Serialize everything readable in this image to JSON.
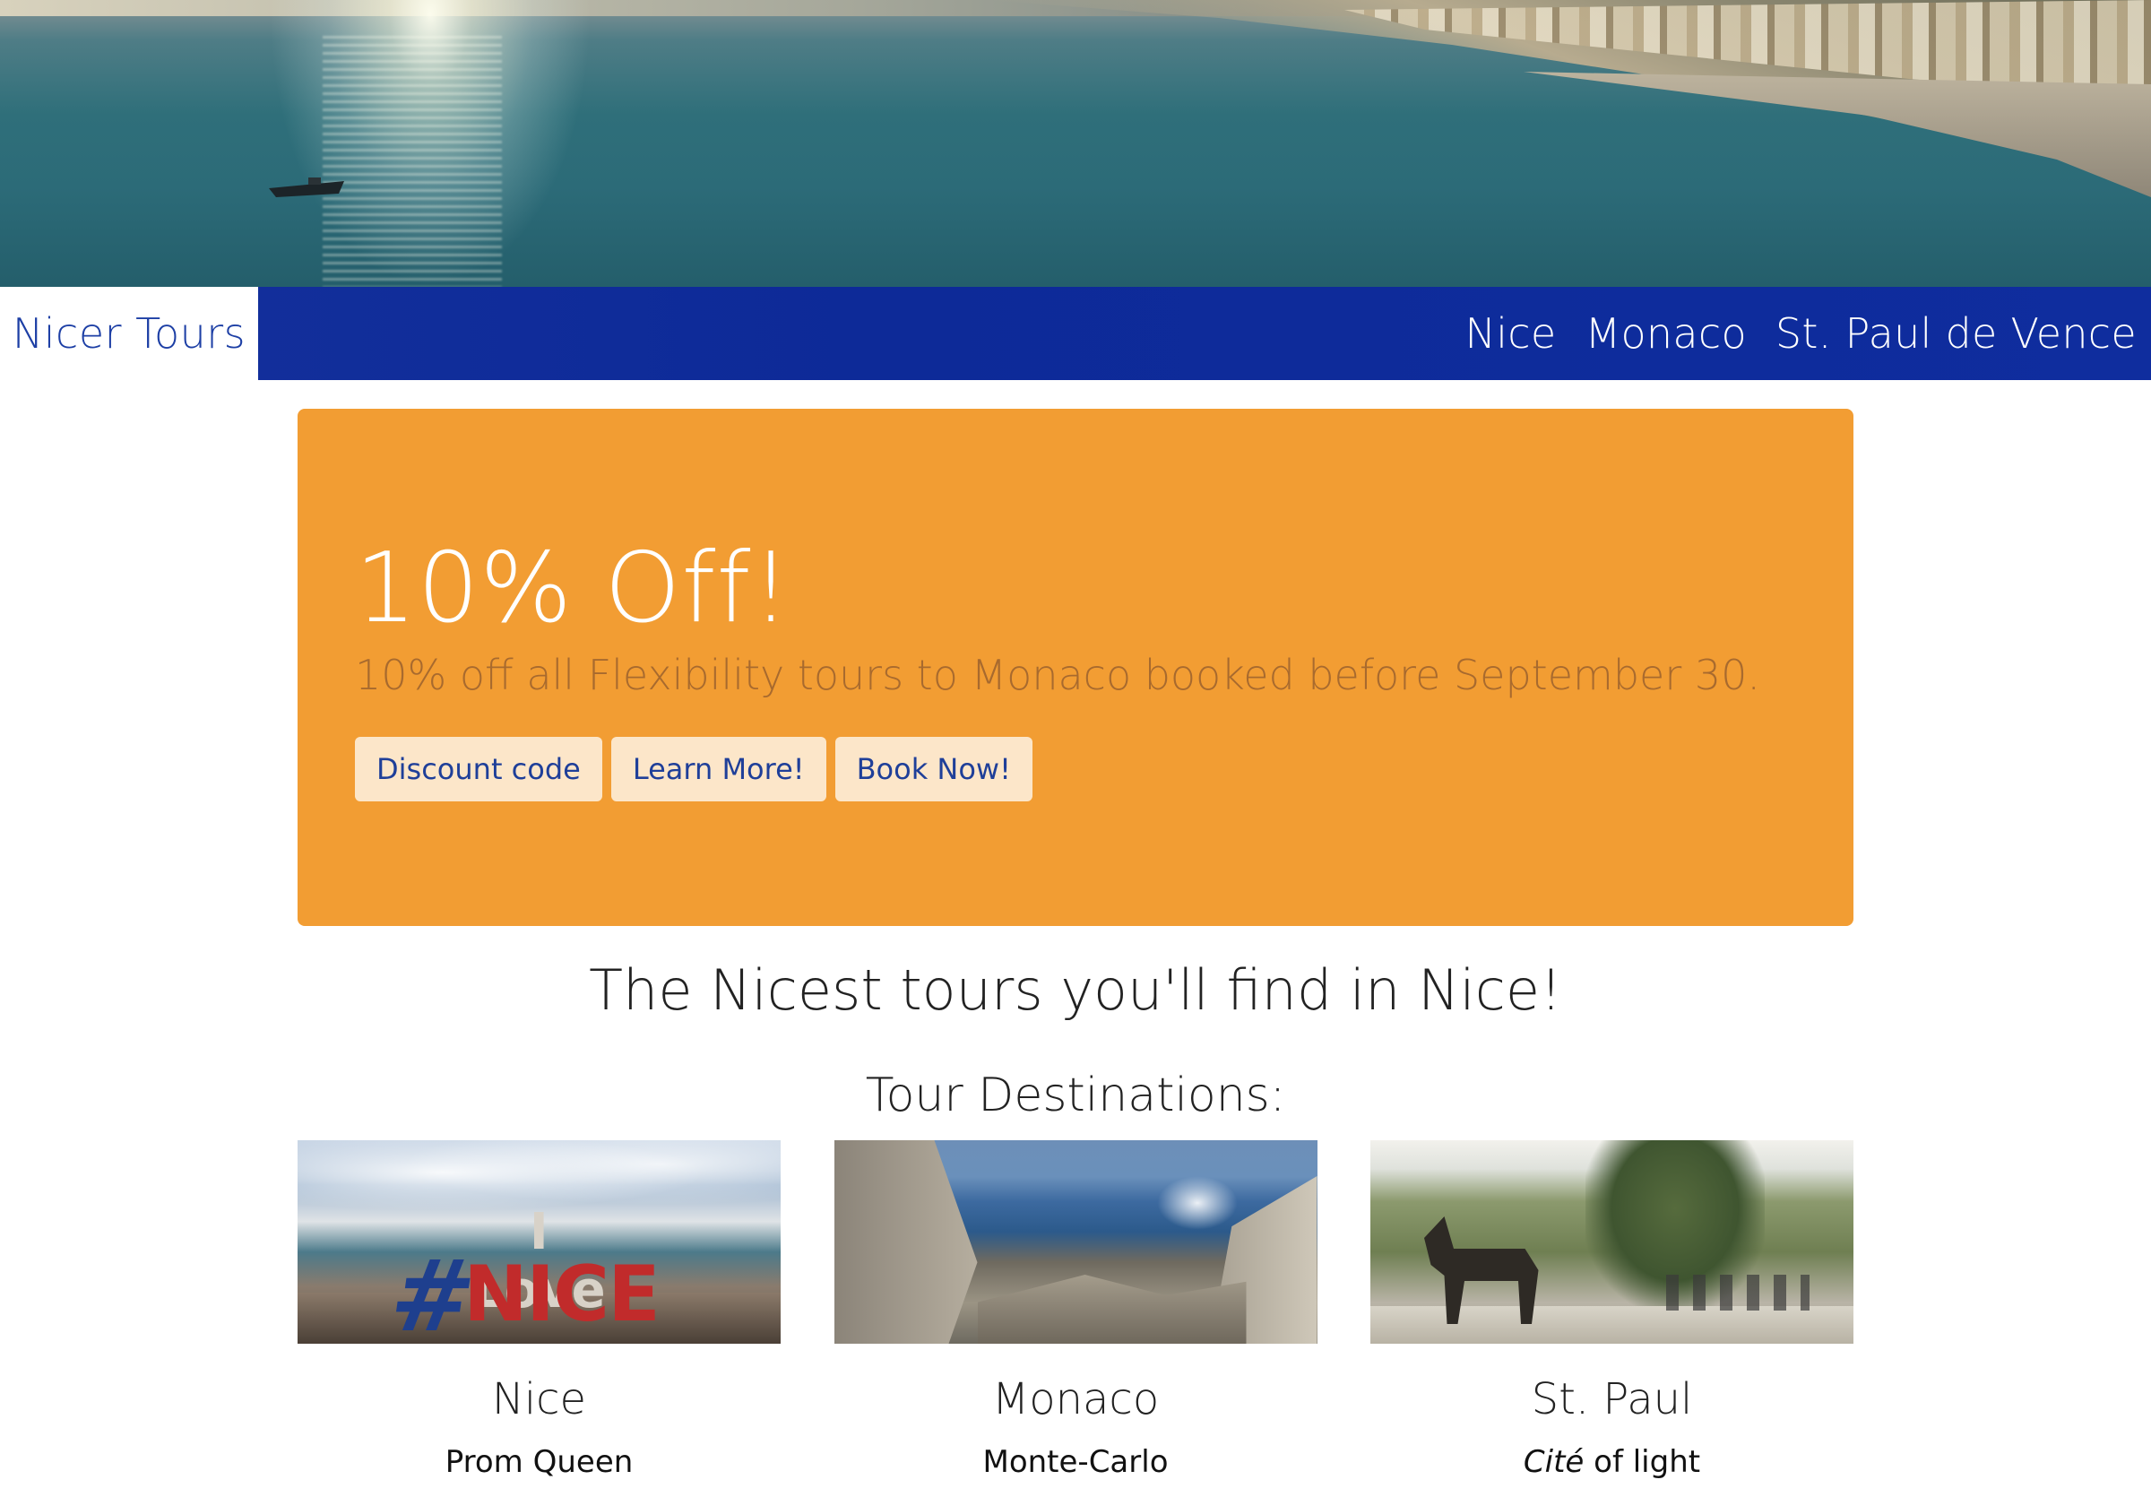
{
  "header": {
    "brand": "Nicer Tours",
    "nav": [
      "Nice",
      "Monaco",
      "St. Paul de Vence"
    ]
  },
  "promo": {
    "title": "10% Off!",
    "text": "10% off all Flexibility tours to Monaco booked before September 30.",
    "buttons": [
      "Discount code",
      "Learn More!",
      "Book Now!"
    ]
  },
  "tagline": "The Nicest tours you'll find in Nice!",
  "destinations": {
    "title": "Tour Destinations:",
    "cards": [
      {
        "name": "Nice",
        "subtitle": "Prom Queen"
      },
      {
        "name": "Monaco",
        "subtitle": "Monte-Carlo"
      },
      {
        "name": "St. Paul",
        "subtitle_italic": "Cité",
        "subtitle_rest": " of light"
      }
    ]
  },
  "images": {
    "nice_sign_hash": "#",
    "nice_sign_top": "I Love",
    "nice_sign_word": "NICE"
  },
  "colors": {
    "nav_blue": "#0f2d9e",
    "promo_orange": "#f29d33",
    "button_bg": "#fce6c9",
    "link_blue": "#1d3fa5"
  }
}
